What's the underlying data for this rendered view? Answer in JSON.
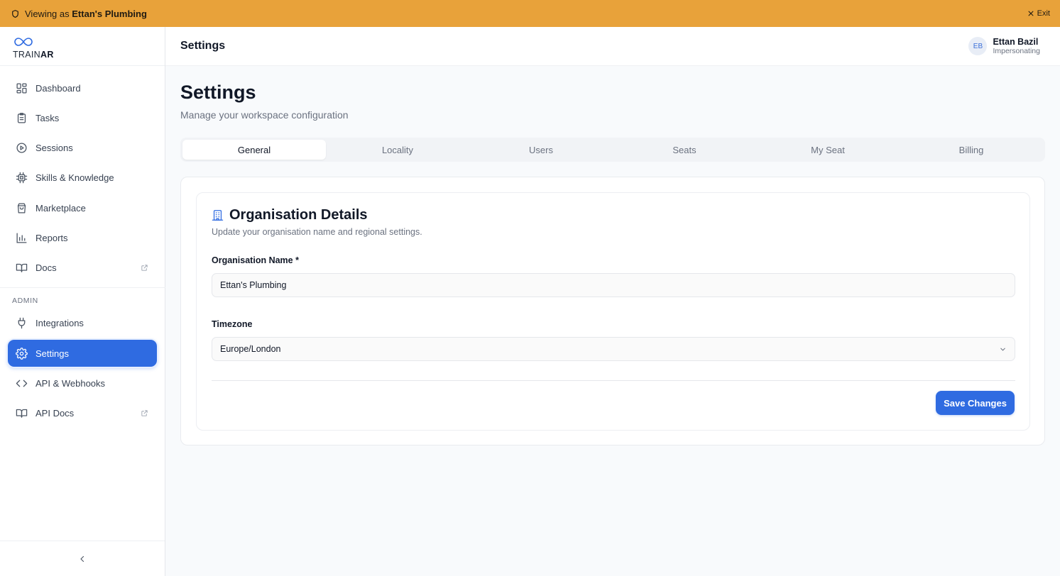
{
  "banner": {
    "prefix": "Viewing as",
    "org": "Ettan's Plumbing",
    "exit_label": "Exit",
    "color": "#e8a23a"
  },
  "brand": {
    "name_light": "TRAIN",
    "name_bold": "AR",
    "accent": "#2f6be1"
  },
  "sidebar": {
    "items": [
      {
        "label": "Dashboard",
        "icon": "dashboard-icon"
      },
      {
        "label": "Tasks",
        "icon": "clipboard-icon"
      },
      {
        "label": "Sessions",
        "icon": "play-circle-icon"
      },
      {
        "label": "Skills & Knowledge",
        "icon": "chip-icon"
      },
      {
        "label": "Marketplace",
        "icon": "shopping-bag-icon"
      },
      {
        "label": "Reports",
        "icon": "bar-chart-icon"
      },
      {
        "label": "Docs",
        "icon": "book-icon",
        "external": true
      }
    ],
    "admin_label": "ADMIN",
    "admin_items": [
      {
        "label": "Integrations",
        "icon": "plug-icon"
      },
      {
        "label": "Settings",
        "icon": "gear-icon",
        "active": true
      },
      {
        "label": "API & Webhooks",
        "icon": "code-icon"
      },
      {
        "label": "API Docs",
        "icon": "book-icon",
        "external": true
      }
    ],
    "collapse_icon": "chevron-left-icon"
  },
  "header": {
    "title": "Settings",
    "user": {
      "initials": "EB",
      "name": "Ettan Bazil",
      "role": "Impersonating"
    }
  },
  "page": {
    "title": "Settings",
    "subtitle": "Manage your workspace configuration"
  },
  "tabs": [
    {
      "label": "General",
      "active": true
    },
    {
      "label": "Locality"
    },
    {
      "label": "Users"
    },
    {
      "label": "Seats"
    },
    {
      "label": "My Seat"
    },
    {
      "label": "Billing"
    }
  ],
  "card": {
    "icon": "building-icon",
    "title": "Organisation Details",
    "subtitle": "Update your organisation name and regional settings.",
    "org_name_label": "Organisation Name *",
    "org_name_value": "Ettan's Plumbing",
    "timezone_label": "Timezone",
    "timezone_value": "Europe/London",
    "save_label": "Save Changes"
  }
}
